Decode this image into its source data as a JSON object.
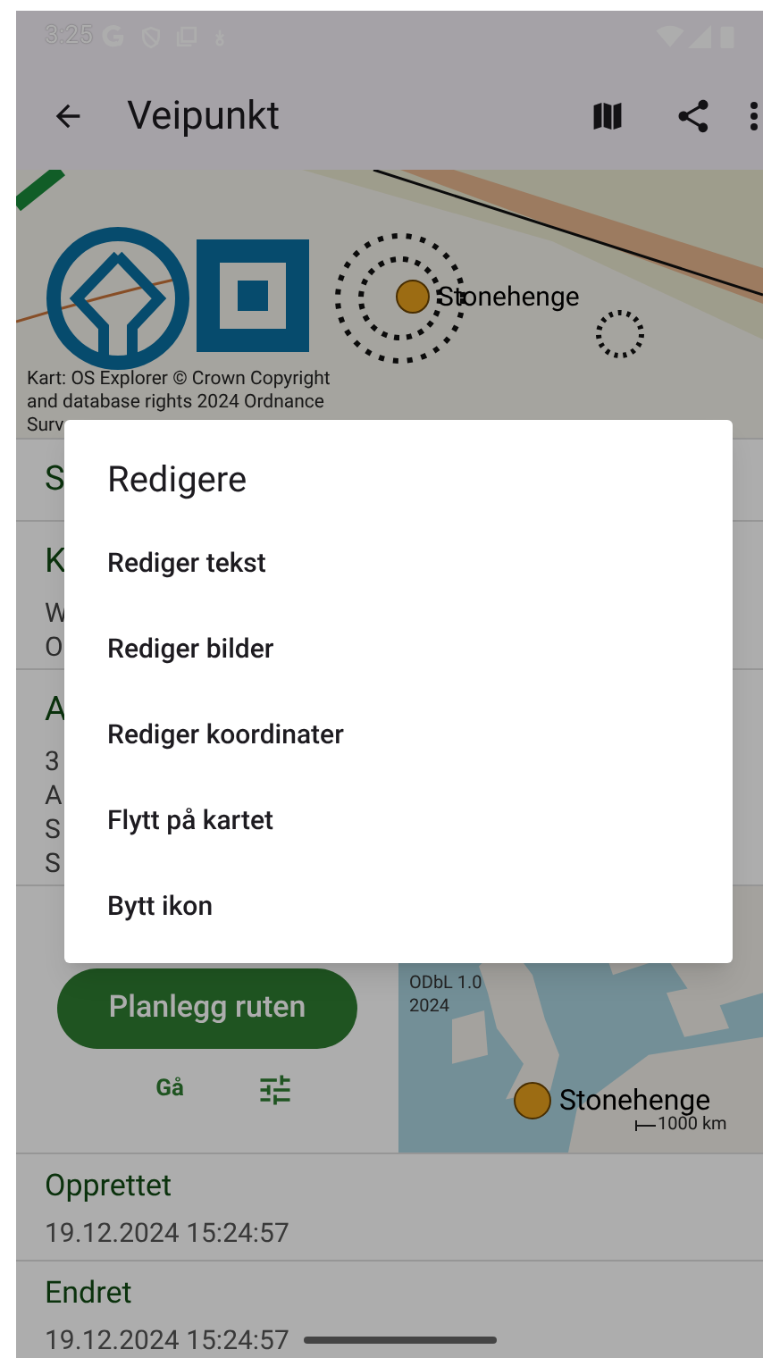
{
  "status_bar": {
    "time": "3:25"
  },
  "app_bar": {
    "title": "Veipunkt"
  },
  "map": {
    "marker_label": "Stonehenge",
    "attribution": [
      "Kart: OS Explorer © Crown Copyright",
      "and database rights 2024 Ordnance",
      "Surv"
    ]
  },
  "sections": [
    {
      "title": "S"
    },
    {
      "title": "K",
      "lines": [
        "W",
        "O"
      ]
    },
    {
      "title": "A",
      "lines": [
        "3",
        "A",
        "S",
        "S"
      ]
    }
  ],
  "route": {
    "button": "Planlegg ruten",
    "mode": "Gå"
  },
  "mini_map": {
    "attribution": [
      "ODbL 1.0",
      "2024"
    ],
    "marker_label": "Stonehenge",
    "scale": "1000 km"
  },
  "details": [
    {
      "label": "Opprettet",
      "value": "19.12.2024 15:24:57"
    },
    {
      "label": "Endret",
      "value": "19.12.2024 15:24:57"
    }
  ],
  "dialog": {
    "title": "Redigere",
    "items": [
      "Rediger tekst",
      "Rediger bilder",
      "Rediger koordinater",
      "Flytt på kartet",
      "Bytt ikon"
    ]
  }
}
